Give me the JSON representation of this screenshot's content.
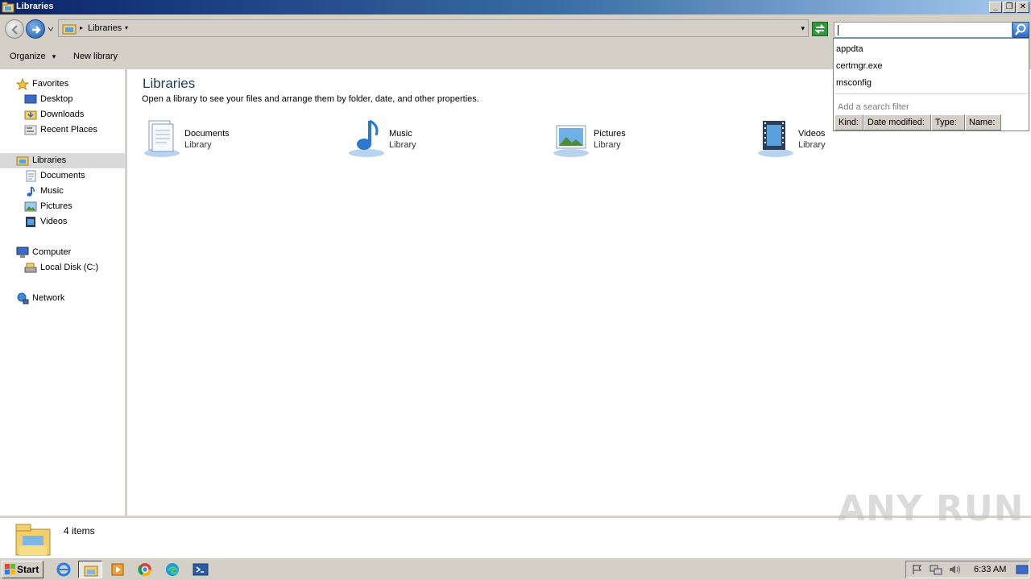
{
  "window": {
    "title": "Libraries",
    "buttons": {
      "minimize": "_",
      "restore": "❐",
      "close": "✕"
    }
  },
  "address": {
    "crumb": "Libraries",
    "separator": "▸",
    "dropdown": "▾"
  },
  "toolbar": {
    "organize": "Organize",
    "organize_arrow": "▾",
    "new_library": "New library"
  },
  "nav": {
    "favorites": {
      "label": "Favorites",
      "items": [
        "Desktop",
        "Downloads",
        "Recent Places"
      ]
    },
    "libraries": {
      "label": "Libraries",
      "items": [
        "Documents",
        "Music",
        "Pictures",
        "Videos"
      ]
    },
    "computer": {
      "label": "Computer",
      "items": [
        "Local Disk (C:)"
      ]
    },
    "network": {
      "label": "Network"
    }
  },
  "content": {
    "heading": "Libraries",
    "subtitle": "Open a library to see your files and arrange them by folder, date, and other properties.",
    "libraries": [
      {
        "name": "Documents",
        "type": "Library",
        "icon": "documents-library-icon"
      },
      {
        "name": "Music",
        "type": "Library",
        "icon": "music-library-icon"
      },
      {
        "name": "Pictures",
        "type": "Library",
        "icon": "pictures-library-icon"
      },
      {
        "name": "Videos",
        "type": "Library",
        "icon": "videos-library-icon"
      }
    ]
  },
  "search": {
    "value": "",
    "suggestions": [
      "appdta",
      "certmgr.exe",
      "msconfig"
    ],
    "filter_hint": "Add a search filter",
    "filters": [
      "Kind:",
      "Date modified:",
      "Type:",
      "Name:"
    ]
  },
  "status": {
    "item_count": "4 items"
  },
  "watermark": "ANY RUN",
  "taskbar": {
    "start": "Start",
    "apps": [
      "internet-explorer",
      "windows-explorer",
      "media-player",
      "chrome",
      "edge",
      "powershell"
    ],
    "active_app": "windows-explorer",
    "clock": "6:33 AM"
  },
  "colors": {
    "titlebar_start": "#0a246a",
    "titlebar_end": "#a6caf0",
    "chrome_gray": "#d4d0c8",
    "heading_blue": "#1e395b",
    "nav_selected": "#d9d9d9"
  }
}
